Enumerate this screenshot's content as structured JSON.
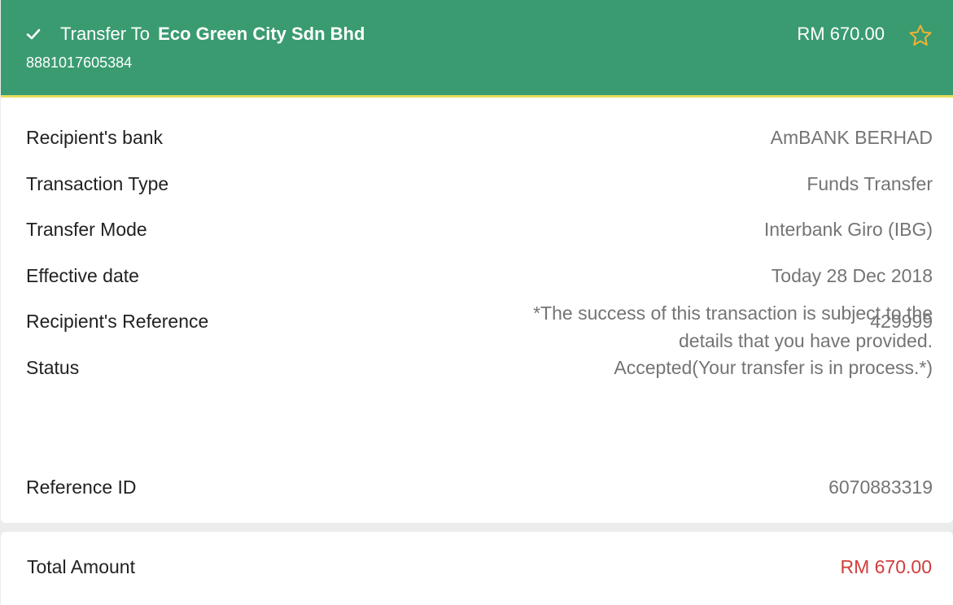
{
  "header": {
    "status_icon": "check-icon",
    "title_prefix": "Transfer To",
    "payee": "Eco Green City Sdn Bhd",
    "account_number": "8881017605384",
    "amount": "RM 670.00",
    "favourite_icon": "star-outline-icon",
    "background_color": "#3a9b70",
    "accent_color": "#e8dd5f"
  },
  "details": {
    "rows": [
      {
        "label": "Recipient's bank",
        "value": "AmBANK BERHAD"
      },
      {
        "label": "Transaction Type",
        "value": "Funds Transfer"
      },
      {
        "label": "Transfer Mode",
        "value": "Interbank Giro (IBG)"
      },
      {
        "label": "Effective date",
        "value": "Today 28 Dec 2018"
      },
      {
        "label": "Recipient's Reference",
        "value": "429999"
      },
      {
        "label": "Status",
        "value": "Accepted(Your transfer is in process.*)"
      }
    ],
    "note": "*The success of this transaction is subject to the details that you have provided.",
    "reference_id_label": "Reference ID",
    "reference_id_value": "6070883319"
  },
  "total": {
    "label": "Total Amount",
    "value": "RM 670.00",
    "value_color": "#d23c3c"
  }
}
